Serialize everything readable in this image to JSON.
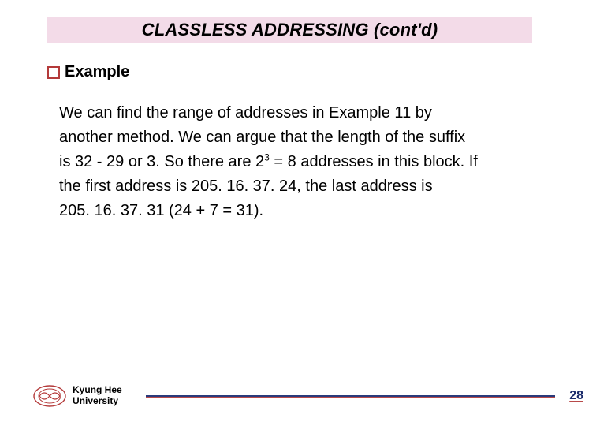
{
  "title": "CLASSLESS ADDRESSING (cont'd)",
  "section_label": "Example",
  "body": {
    "line1": "We can find the range of addresses in Example 11 by",
    "line2": "another method. We can argue that the length of the suffix",
    "line3a": "is 32 - 29 or 3. So there are 2",
    "line3_exp": "3",
    "line3b": " = 8 addresses in this block. If",
    "line4": "the first address is 205. 16. 37. 24, the last address is",
    "line5": "205. 16. 37. 31 (24 + 7 = 31)."
  },
  "footer": {
    "uni1": "Kyung Hee",
    "uni2": "University",
    "page": "28"
  }
}
